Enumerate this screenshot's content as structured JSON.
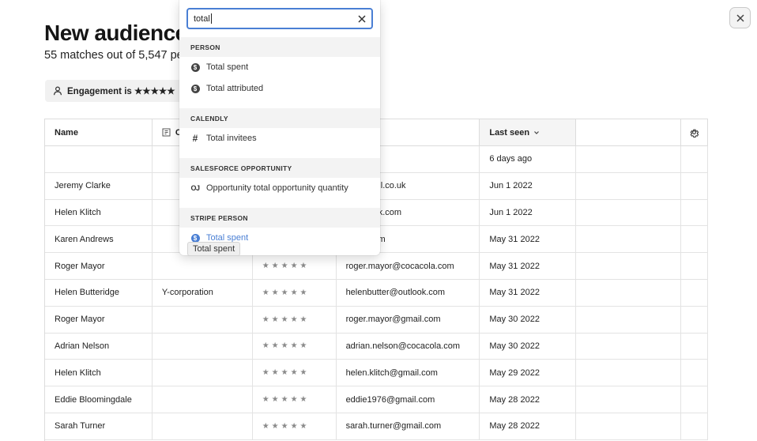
{
  "page": {
    "title": "New audience",
    "subtitle": "55 matches out of 5,547 pe",
    "filter_chip": "Engagement is ★★★★★"
  },
  "icons": {
    "close": "close-icon",
    "person": "person-icon",
    "settings": "gear-icon",
    "sort": "chevron-down-icon"
  },
  "colors": {
    "accent": "#4a7fd4",
    "header_bg": "#f5f5f5",
    "section_bg": "#f3f3f3"
  },
  "table": {
    "columns": [
      "Name",
      "C",
      "",
      "",
      "Last seen",
      ""
    ],
    "sorted_column": "Last seen",
    "rows": [
      {
        "name": "",
        "company": "",
        "engagement": "",
        "email": "rtto.com",
        "last_seen": "6 days ago"
      },
      {
        "name": "Jeremy Clarke",
        "company": "",
        "engagement": "",
        "email": "@hotmail.co.uk",
        "last_seen": "Jun 1 2022"
      },
      {
        "name": "Helen Klitch",
        "company": "",
        "engagement": "",
        "email": "@outlook.com",
        "last_seen": "Jun 1 2022"
      },
      {
        "name": "Karen Andrews",
        "company": "",
        "engagement": "",
        "email": "gmail.com",
        "last_seen": "May 31 2022"
      },
      {
        "name": "Roger Mayor",
        "company": "",
        "engagement": "★★★★★",
        "email": "roger.mayor@cocacola.com",
        "last_seen": "May 31 2022"
      },
      {
        "name": "Helen Butteridge",
        "company": "Y-corporation",
        "engagement": "★★★★★",
        "email": "helenbutter@outlook.com",
        "last_seen": "May 31 2022"
      },
      {
        "name": "Roger Mayor",
        "company": "",
        "engagement": "★★★★★",
        "email": "roger.mayor@gmail.com",
        "last_seen": "May 30 2022"
      },
      {
        "name": "Adrian Nelson",
        "company": "",
        "engagement": "★★★★★",
        "email": "adrian.nelson@cocacola.com",
        "last_seen": "May 30 2022"
      },
      {
        "name": "Helen Klitch",
        "company": "",
        "engagement": "★★★★★",
        "email": "helen.klitch@gmail.com",
        "last_seen": "May 29 2022"
      },
      {
        "name": "Eddie Bloomingdale",
        "company": "",
        "engagement": "★★★★★",
        "email": "eddie1976@gmail.com",
        "last_seen": "May 28 2022"
      },
      {
        "name": "Sarah Turner",
        "company": "",
        "engagement": "★★★★★",
        "email": "sarah.turner@gmail.com",
        "last_seen": "May 28 2022"
      }
    ]
  },
  "dropdown": {
    "search_value": "total",
    "sections": [
      {
        "title": "PERSON",
        "items": [
          {
            "label": "Total spent",
            "icon": "dollar-icon"
          },
          {
            "label": "Total attributed",
            "icon": "dollar-icon"
          }
        ]
      },
      {
        "title": "CALENDLY",
        "items": [
          {
            "label": "Total invitees",
            "icon": "hash-icon"
          }
        ]
      },
      {
        "title": "SALESFORCE OPPORTUNITY",
        "items": [
          {
            "label": "Opportunity total opportunity quantity",
            "icon": "oj-icon"
          }
        ]
      },
      {
        "title": "STRIPE PERSON",
        "items": [
          {
            "label": "Total spent",
            "icon": "dollar-icon",
            "highlighted": true
          }
        ]
      }
    ],
    "tooltip": "Total spent"
  }
}
